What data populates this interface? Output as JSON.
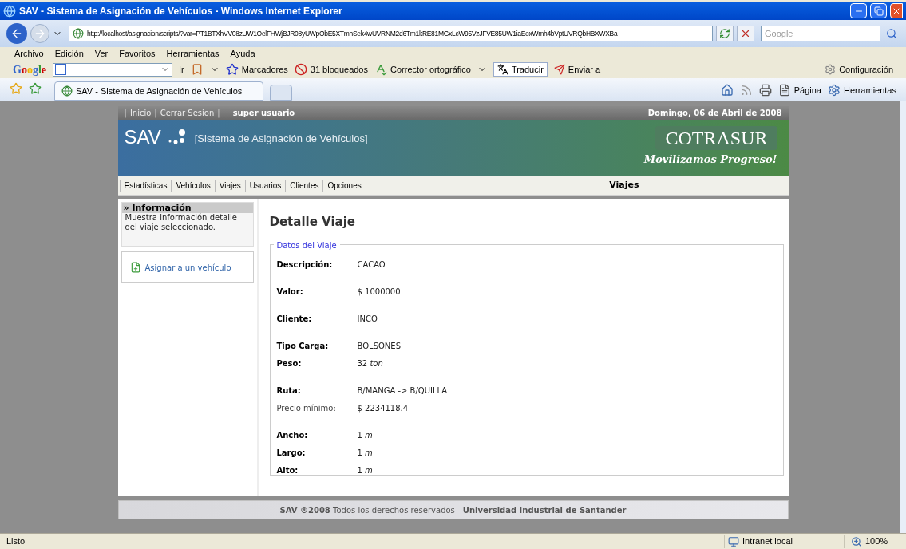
{
  "window": {
    "title": "SAV - Sistema de Asignación de Vehículos - Windows Internet Explorer"
  },
  "address": {
    "url": "http://localhost/asignacion/scripts/?var=PT1BTXhVV08zUW1OelFHWjBJR08yUWpObE5XTmhSek4wUVRNM2d6Tm1kRE81MGxLcW95VzJFVE85UW1iaEoxWmh4bVptUVRQbHBXWXBa"
  },
  "search": {
    "placeholder": "Google"
  },
  "menu": [
    "Archivo",
    "Edición",
    "Ver",
    "Favoritos",
    "Herramientas",
    "Ayuda"
  ],
  "google_toolbar": {
    "logo": "Google",
    "go": "Ir",
    "bookmarks": "Marcadores",
    "blocked": "31 bloqueados",
    "spell": "Corrector ortográfico",
    "translate": "Traducir",
    "send": "Enviar a",
    "settings": "Configuración"
  },
  "tabs": [
    {
      "label": "SAV - Sistema de Asignación de Vehículos",
      "selected": true
    }
  ],
  "command_bar": [
    "Página",
    "Herramientas"
  ],
  "page": {
    "top_bar": {
      "items": [
        {
          "kind": "sep",
          "text": "|"
        },
        {
          "kind": "link",
          "text": "Inicio"
        },
        {
          "kind": "sep",
          "text": "|"
        },
        {
          "kind": "link",
          "text": "Cerrar Sesion"
        },
        {
          "kind": "sep",
          "text": "|"
        }
      ],
      "user": "super usuario",
      "date": "Domingo, 06 de Abril de 2008"
    },
    "banner": {
      "logo": "SAV",
      "subtitle": "[Sistema de Asignación de Vehículos]",
      "brand": "COTRASUR",
      "slogan": "Movilizamos Progreso!"
    },
    "nav": {
      "items": [
        "Estadísticas",
        "Vehículos",
        "Viajes",
        "Usuarios",
        "Clientes",
        "Opciones"
      ],
      "section": "Viajes"
    },
    "sidebar": {
      "title": "» Información",
      "description": "Muestra información detalle del viaje seleccionado.",
      "action": "Asignar a un vehículo"
    },
    "main": {
      "title": "Detalle Viaje",
      "legend": "Datos del Viaje",
      "groups": [
        [
          {
            "label": "Descripción:",
            "bold": true,
            "value": "CACAO"
          }
        ],
        [
          {
            "label": "Valor:",
            "bold": true,
            "value": "$ 1000000"
          }
        ],
        [
          {
            "label": "Cliente:",
            "bold": true,
            "value": "INCO"
          }
        ],
        [
          {
            "label": "Tipo Carga:",
            "bold": true,
            "value": "BOLSONES"
          },
          {
            "label": "Peso:",
            "bold": true,
            "value": "32 *ton*"
          }
        ],
        [
          {
            "label": "Ruta:",
            "bold": true,
            "value": "B/MANGA -> B/QUILLA"
          },
          {
            "label": "Precio mínimo:",
            "bold": false,
            "value": "$ 2234118.4"
          }
        ],
        [
          {
            "label": "Ancho:",
            "bold": true,
            "value": "1 *m*"
          },
          {
            "label": "Largo:",
            "bold": true,
            "value": "1 *m*"
          },
          {
            "label": "Alto:",
            "bold": true,
            "value": "1 *m*"
          }
        ]
      ]
    },
    "footer": "**SAV ®2008** Todos los derechos reservados - **Universidad Industrial de Santander**"
  },
  "status_bar": {
    "text": "Listo",
    "zone": "Intranet local",
    "zoom": "100%"
  }
}
